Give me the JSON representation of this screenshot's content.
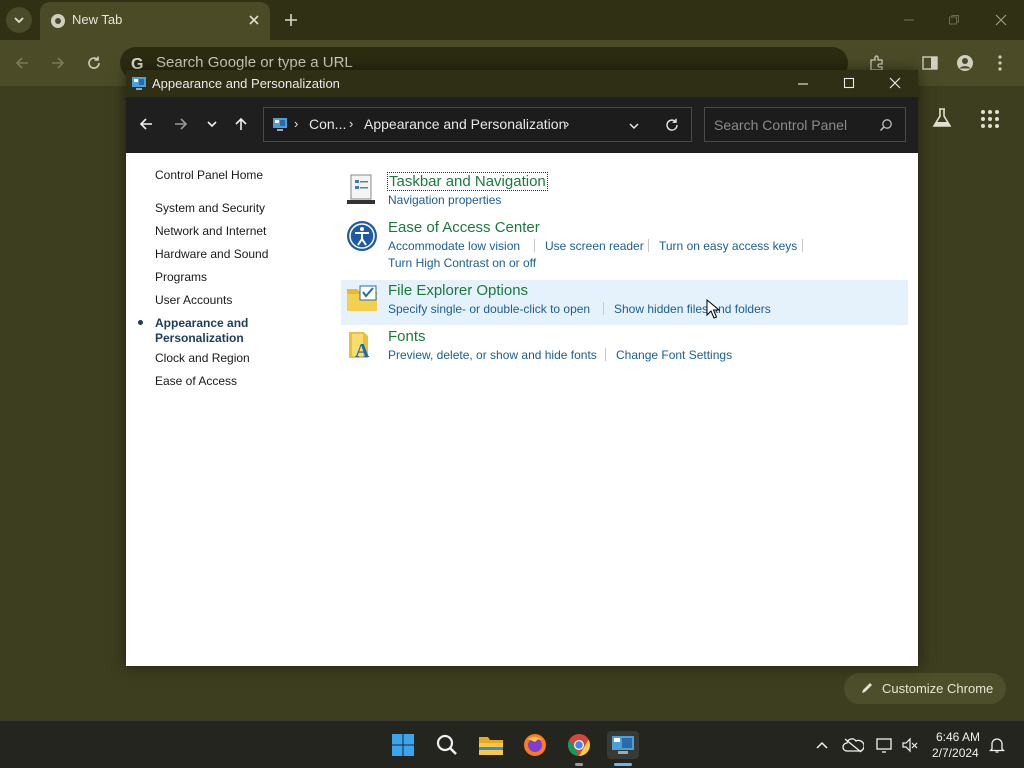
{
  "browser": {
    "tab_title": "New Tab",
    "omnibox_placeholder": "Search Google or type a URL",
    "customize_label": "Customize Chrome"
  },
  "window": {
    "title": "Appearance and Personalization",
    "breadcrumb_root": "Con...",
    "breadcrumb_current": "Appearance and Personalization",
    "search_placeholder": "Search Control Panel"
  },
  "sidebar": {
    "items": [
      {
        "label": "Control Panel Home"
      },
      {
        "label": "System and Security"
      },
      {
        "label": "Network and Internet"
      },
      {
        "label": "Hardware and Sound"
      },
      {
        "label": "Programs"
      },
      {
        "label": "User Accounts"
      },
      {
        "label": "Appearance and"
      },
      {
        "label": "Personalization"
      },
      {
        "label": "Clock and Region"
      },
      {
        "label": "Ease of Access"
      }
    ]
  },
  "categories": [
    {
      "title": "Taskbar and Navigation",
      "icon": "taskbar-icon",
      "links": [
        "Navigation properties"
      ]
    },
    {
      "title": "Ease of Access Center",
      "icon": "ease-of-access-icon",
      "links": [
        "Accommodate low vision",
        "Use screen reader",
        "Turn on easy access keys",
        "Turn High Contrast on or off"
      ]
    },
    {
      "title": "File Explorer Options",
      "icon": "folder-options-icon",
      "links": [
        "Specify single- or double-click to open",
        "Show hidden files and folders"
      ]
    },
    {
      "title": "Fonts",
      "icon": "fonts-icon",
      "links": [
        "Preview, delete, or show and hide fonts",
        "Change Font Settings"
      ]
    }
  ],
  "taskbar": {
    "time": "6:46 AM",
    "date": "2/7/2024"
  },
  "colors": {
    "chrome_bg": "#3d3d1f",
    "link": "#1a5e96",
    "category_title": "#1a7a3a",
    "hover_row": "#e5f1fb"
  }
}
